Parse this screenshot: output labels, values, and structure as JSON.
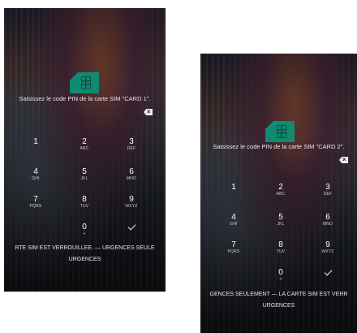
{
  "screens": [
    {
      "prompt": "Saisissez le code PIN de la carte SIM \"CARD 1\".",
      "status": "RTE SIM EST VERROUILLÉE. — URGENCES SEULE",
      "urgences": "URGENCES"
    },
    {
      "prompt": "Saisissez le code PIN de la carte SIM \"CARD 2\".",
      "status": "GENCES SEULEMENT — LA CARTE SIM EST VERR",
      "urgences": "URGENCES"
    }
  ],
  "keypad": [
    {
      "digit": "1",
      "letters": ""
    },
    {
      "digit": "2",
      "letters": "ABC"
    },
    {
      "digit": "3",
      "letters": "DEF"
    },
    {
      "digit": "4",
      "letters": "GHI"
    },
    {
      "digit": "5",
      "letters": "JKL"
    },
    {
      "digit": "6",
      "letters": "MNO"
    },
    {
      "digit": "7",
      "letters": "PQRS"
    },
    {
      "digit": "8",
      "letters": "TUV"
    },
    {
      "digit": "9",
      "letters": "WXYZ"
    },
    {
      "digit": "0",
      "letters": "+"
    }
  ],
  "icons": {
    "sim": "sim-card-icon",
    "backspace": "backspace-icon",
    "confirm": "checkmark-icon"
  },
  "colors": {
    "sim_accent": "#118a72"
  }
}
